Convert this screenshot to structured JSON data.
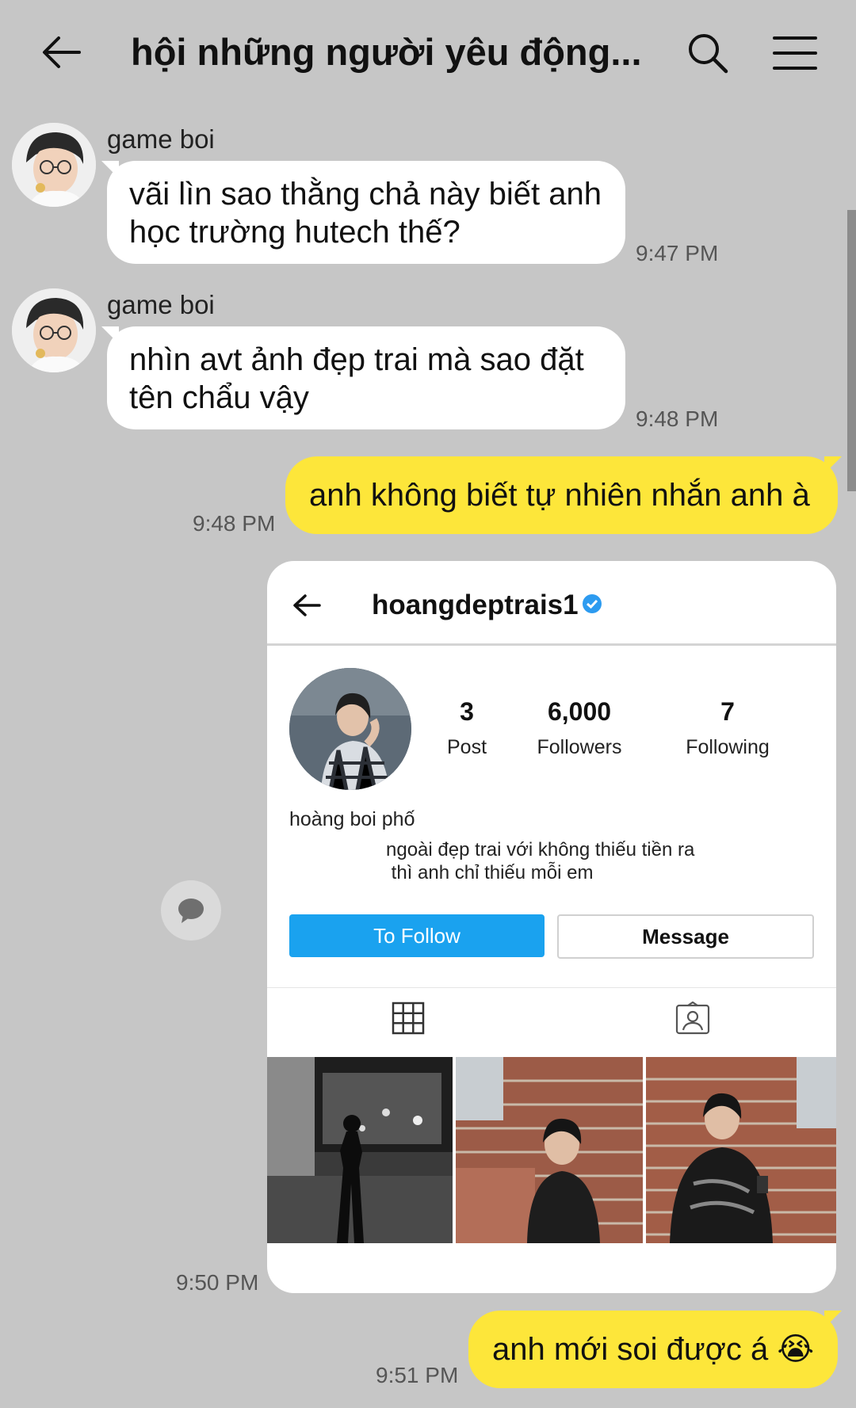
{
  "header": {
    "title": "hội những người yêu động...",
    "icons": [
      "back-arrow-icon",
      "search-icon",
      "menu-icon"
    ]
  },
  "messages": [
    {
      "sender": "game boi",
      "text": "vãi lìn sao thằng chả này biết anh học trường hutech thế?",
      "time": "9:47 PM"
    },
    {
      "sender": "game boi",
      "text": "nhìn avt ảnh đẹp trai mà sao đặt tên chẩu vậy",
      "time": "9:48 PM"
    },
    {
      "text": "anh không biết tự nhiên nhắn anh à",
      "time": "9:48 PM"
    },
    {
      "time": "9:50 PM"
    },
    {
      "text": "anh mới soi được á 😭",
      "time": "9:51 PM"
    }
  ],
  "profile_card": {
    "username": "hoangdeptrais1",
    "stats": [
      {
        "value": "3",
        "label": "Post"
      },
      {
        "value": "6,000",
        "label": "Followers"
      },
      {
        "value": "7",
        "label": "Following"
      }
    ],
    "display_name": "hoàng boi phố",
    "bio": "ngoài đẹp trai với không thiếu tiền ra\n thì anh chỉ thiếu mỗi em",
    "follow_label": "To Follow",
    "message_label": "Message"
  },
  "colors": {
    "background": "#c6c6c6",
    "outgoing_bubble": "#fde63a",
    "incoming_bubble": "#ffffff",
    "follow_button": "#1aa2ef",
    "verified_badge": "#2d9bf0"
  }
}
